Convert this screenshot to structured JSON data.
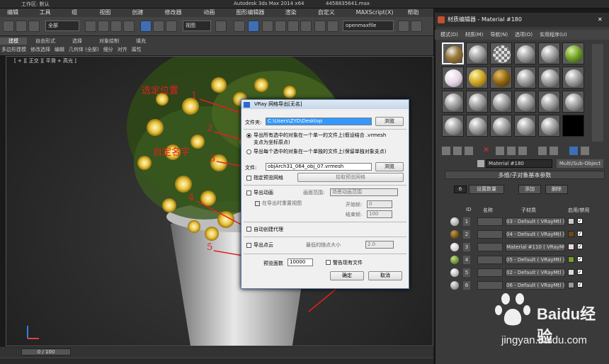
{
  "app": {
    "title": "Autodesk 3ds Max  2014 x64",
    "file": "4458835641.max",
    "workspace": "工作区: 默认"
  },
  "menubar": [
    "编辑(E)",
    "工具(T)",
    "组(G)",
    "视图(V)",
    "创建(C)",
    "修改器(M)",
    "动画(A)",
    "图形编辑器(D)",
    "渲染(R)",
    "自定义(U)",
    "MAXScript(X)",
    "帮助(H)"
  ],
  "toolbar": {
    "selection_filter": "全部",
    "view_select": "视图",
    "named_set": "openmaxfile"
  },
  "ribbon": {
    "tabs": [
      "建模",
      "自由形式",
      "选择",
      "对象绘制",
      "填充"
    ],
    "subtabs": [
      "多边形建模",
      "修改选择",
      "编辑",
      "几何体 (全部)",
      "细分",
      "对齐",
      "属性"
    ]
  },
  "viewport": {
    "label": "[ + ][ 正交 ][ 平滑 + 高光 ]"
  },
  "timeline": {
    "frame": "0 / 100"
  },
  "annotations": {
    "a1": "选定位置",
    "n1": "1",
    "a2": "自定名字",
    "n2": "2",
    "n3": "3",
    "n4": "4",
    "n5": "5"
  },
  "dialog": {
    "title": "VRay 网格导出[无名]",
    "folder_label": "文件夹:",
    "folder_value": "C:\\Users\\ZYD\\Desktop",
    "browse1": "浏览",
    "radio1_line1": "导出所有选中的对象在一个单一的文件上(假设结合 .vrmesh",
    "radio1_line2": "支点为坐标原点)",
    "radio2": "导出每个选中的对象在一个单独的文件上(保留单独对象支点)",
    "file_label": "文件:",
    "file_value": "objArch31_064_obj_07.vrmesh",
    "browse2": "浏览",
    "preview_mesh": "指定预览网格",
    "pick_preview": "拾取预览网格",
    "export_anim": "导出动画",
    "frame_range_label": "画面范围:",
    "frame_range_value": "场景动画范围",
    "in_export_range": "在导出时重置视图",
    "start_label": "开始帧:",
    "start_value": "0",
    "end_label": "结束帧:",
    "end_value": "100",
    "auto_proxy": "自动创建代理",
    "export_points": "导出点云",
    "min_point_label": "最低的随点大小",
    "min_point_value": "2.0",
    "preview_faces_label": "预览面数",
    "preview_faces_value": "10000",
    "warn_existing": "警告现有文件",
    "ok": "确定",
    "cancel": "取消"
  },
  "material_editor": {
    "title": "材质编辑器 - Material #180",
    "menu": [
      "模式(D)",
      "材质(M)",
      "导航(N)",
      "选项(O)",
      "实用程序(U)"
    ],
    "material_name": "Material #180",
    "material_type": "Multi/Sub-Object",
    "rollout_title": "多维/子对象基本参数",
    "count": "6",
    "set_count": "设置数量",
    "add": "添加",
    "delete": "删除",
    "headers": {
      "id": "ID",
      "name": "名称",
      "submat": "子材质",
      "enable": "启用/禁用"
    },
    "rows": [
      {
        "id": "1",
        "mat": "03 - Default ( VRayMtl )",
        "color": "#c8c8c8"
      },
      {
        "id": "2",
        "mat": "04 - Default ( VRayMtl )",
        "color": "#6b4a12"
      },
      {
        "id": "3",
        "mat": "Material #110 ( VRayMtl )",
        "color": "#e8d8e4"
      },
      {
        "id": "4",
        "mat": "05 - Default ( VRayMtl )",
        "color": "#7a9a2a"
      },
      {
        "id": "5",
        "mat": "02 - Default ( VRayMtl )",
        "color": "#d8d8d8"
      },
      {
        "id": "6",
        "mat": "06 - Default ( VRayMtl )",
        "color": "#9a9a9a"
      }
    ]
  },
  "watermark": {
    "brand": "Baidu经验",
    "url": "jingyan.baidu.com"
  }
}
